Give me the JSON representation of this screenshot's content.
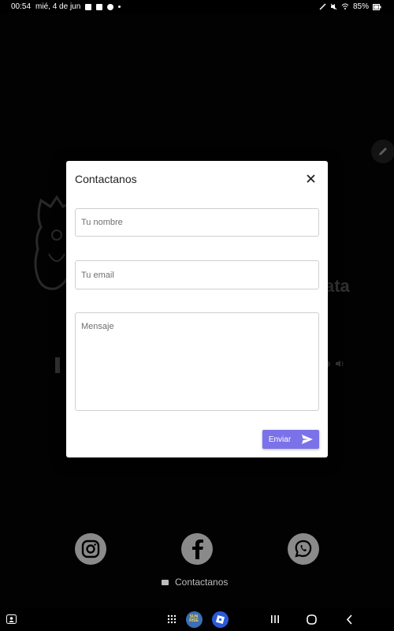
{
  "status_bar": {
    "time": "00:54",
    "date": "mié, 4 de jun",
    "battery": "85%"
  },
  "background": {
    "logo_text": "ata"
  },
  "dialog": {
    "title": "Contactanos",
    "name_placeholder": "Tu nombre",
    "email_placeholder": "Tu email",
    "message_placeholder": "Mensaje",
    "send_label": "Enviar",
    "accent_color": "#7b72e9"
  },
  "footer": {
    "social": [
      "instagram",
      "facebook",
      "whatsapp"
    ],
    "contact_label": "Contactanos"
  },
  "nav_bar": {
    "app_badge_text": "SUN RISE"
  }
}
